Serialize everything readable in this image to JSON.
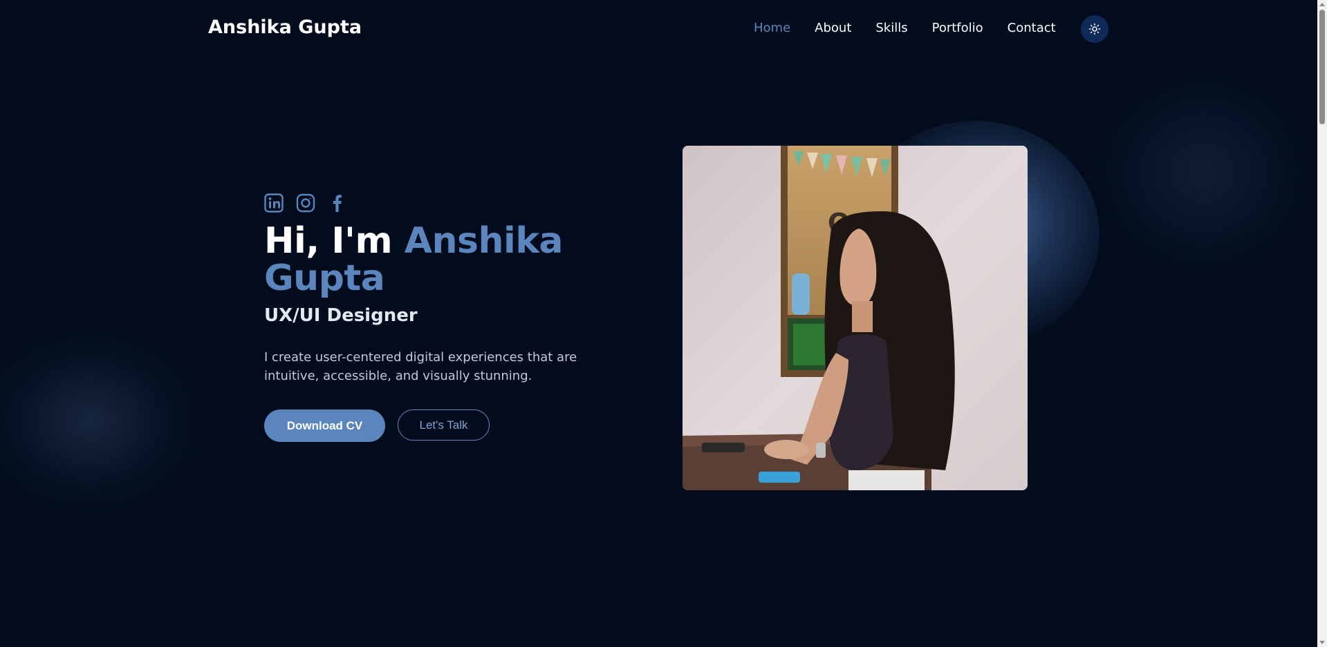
{
  "header": {
    "logo": "Anshika Gupta",
    "nav": [
      {
        "label": "Home",
        "active": true
      },
      {
        "label": "About",
        "active": false
      },
      {
        "label": "Skills",
        "active": false
      },
      {
        "label": "Portfolio",
        "active": false
      },
      {
        "label": "Contact",
        "active": false
      }
    ],
    "theme_toggle_icon": "sun-icon"
  },
  "hero": {
    "socials": [
      "linkedin-icon",
      "instagram-icon",
      "facebook-icon"
    ],
    "title_prefix": "Hi, I'm ",
    "title_name": "Anshika Gupta",
    "role": "UX/UI Designer",
    "description": "I create user-centered digital experiences that are intuitive, accessible, and visually stunning.",
    "primary_button": "Download CV",
    "secondary_button": "Let's Talk"
  },
  "colors": {
    "background": "#020c1d",
    "accent": "#5b86bd",
    "toggle_bg": "#0e2a58"
  }
}
